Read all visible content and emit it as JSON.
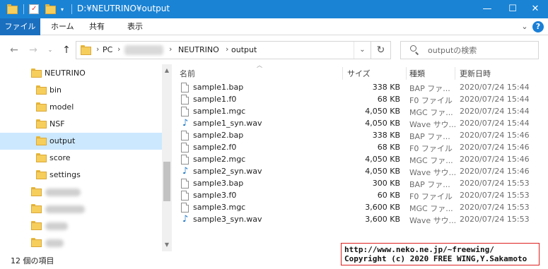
{
  "window": {
    "title": "D:¥NEUTRINO¥output",
    "minimize_icon": "minimize-icon",
    "maximize_icon": "maximize-icon",
    "close_icon": "close-icon"
  },
  "ribbon": {
    "file": "ファイル",
    "tabs": [
      "ホーム",
      "共有",
      "表示"
    ],
    "help": "?"
  },
  "address": {
    "crumbs": [
      "PC",
      "NEUTRINO",
      "output"
    ]
  },
  "search": {
    "placeholder": "outputの検索"
  },
  "nav": {
    "items": [
      {
        "label": "NEUTRINO"
      },
      {
        "label": "bin"
      },
      {
        "label": "model"
      },
      {
        "label": "NSF"
      },
      {
        "label": "output"
      },
      {
        "label": "score"
      },
      {
        "label": "settings"
      }
    ]
  },
  "columns": {
    "name": "名前",
    "size": "サイズ",
    "type": "種類",
    "date": "更新日時"
  },
  "files": [
    {
      "name": "sample1.bap",
      "size": "338 KB",
      "type": "BAP ファ...",
      "date": "2020/07/24 15:44",
      "icon": "file"
    },
    {
      "name": "sample1.f0",
      "size": "68 KB",
      "type": "F0 ファイル",
      "date": "2020/07/24 15:44",
      "icon": "file"
    },
    {
      "name": "sample1.mgc",
      "size": "4,050 KB",
      "type": "MGC ファ...",
      "date": "2020/07/24 15:44",
      "icon": "file"
    },
    {
      "name": "sample1_syn.wav",
      "size": "4,050 KB",
      "type": "Wave サウ...",
      "date": "2020/07/24 15:44",
      "icon": "wav"
    },
    {
      "name": "sample2.bap",
      "size": "338 KB",
      "type": "BAP ファ...",
      "date": "2020/07/24 15:46",
      "icon": "file"
    },
    {
      "name": "sample2.f0",
      "size": "68 KB",
      "type": "F0 ファイル",
      "date": "2020/07/24 15:46",
      "icon": "file"
    },
    {
      "name": "sample2.mgc",
      "size": "4,050 KB",
      "type": "MGC ファ...",
      "date": "2020/07/24 15:46",
      "icon": "file"
    },
    {
      "name": "sample2_syn.wav",
      "size": "4,050 KB",
      "type": "Wave サウ...",
      "date": "2020/07/24 15:46",
      "icon": "wav"
    },
    {
      "name": "sample3.bap",
      "size": "300 KB",
      "type": "BAP ファ...",
      "date": "2020/07/24 15:53",
      "icon": "file"
    },
    {
      "name": "sample3.f0",
      "size": "60 KB",
      "type": "F0 ファイル",
      "date": "2020/07/24 15:53",
      "icon": "file"
    },
    {
      "name": "sample3.mgc",
      "size": "3,600 KB",
      "type": "MGC ファ...",
      "date": "2020/07/24 15:53",
      "icon": "file"
    },
    {
      "name": "sample3_syn.wav",
      "size": "3,600 KB",
      "type": "Wave サウ...",
      "date": "2020/07/24 15:53",
      "icon": "wav"
    }
  ],
  "status": {
    "count": "12 個の項目"
  },
  "watermark": {
    "line1": "http://www.neko.ne.jp/~freewing/",
    "line2": "Copyright (c) 2020 FREE WING,Y.Sakamoto"
  },
  "colors": {
    "titlebar": "#1a83d4",
    "file_tab": "#1a6fbf",
    "selected": "#cce8ff",
    "folder": "#f6ce5c",
    "watermark_border": "#e02020"
  }
}
